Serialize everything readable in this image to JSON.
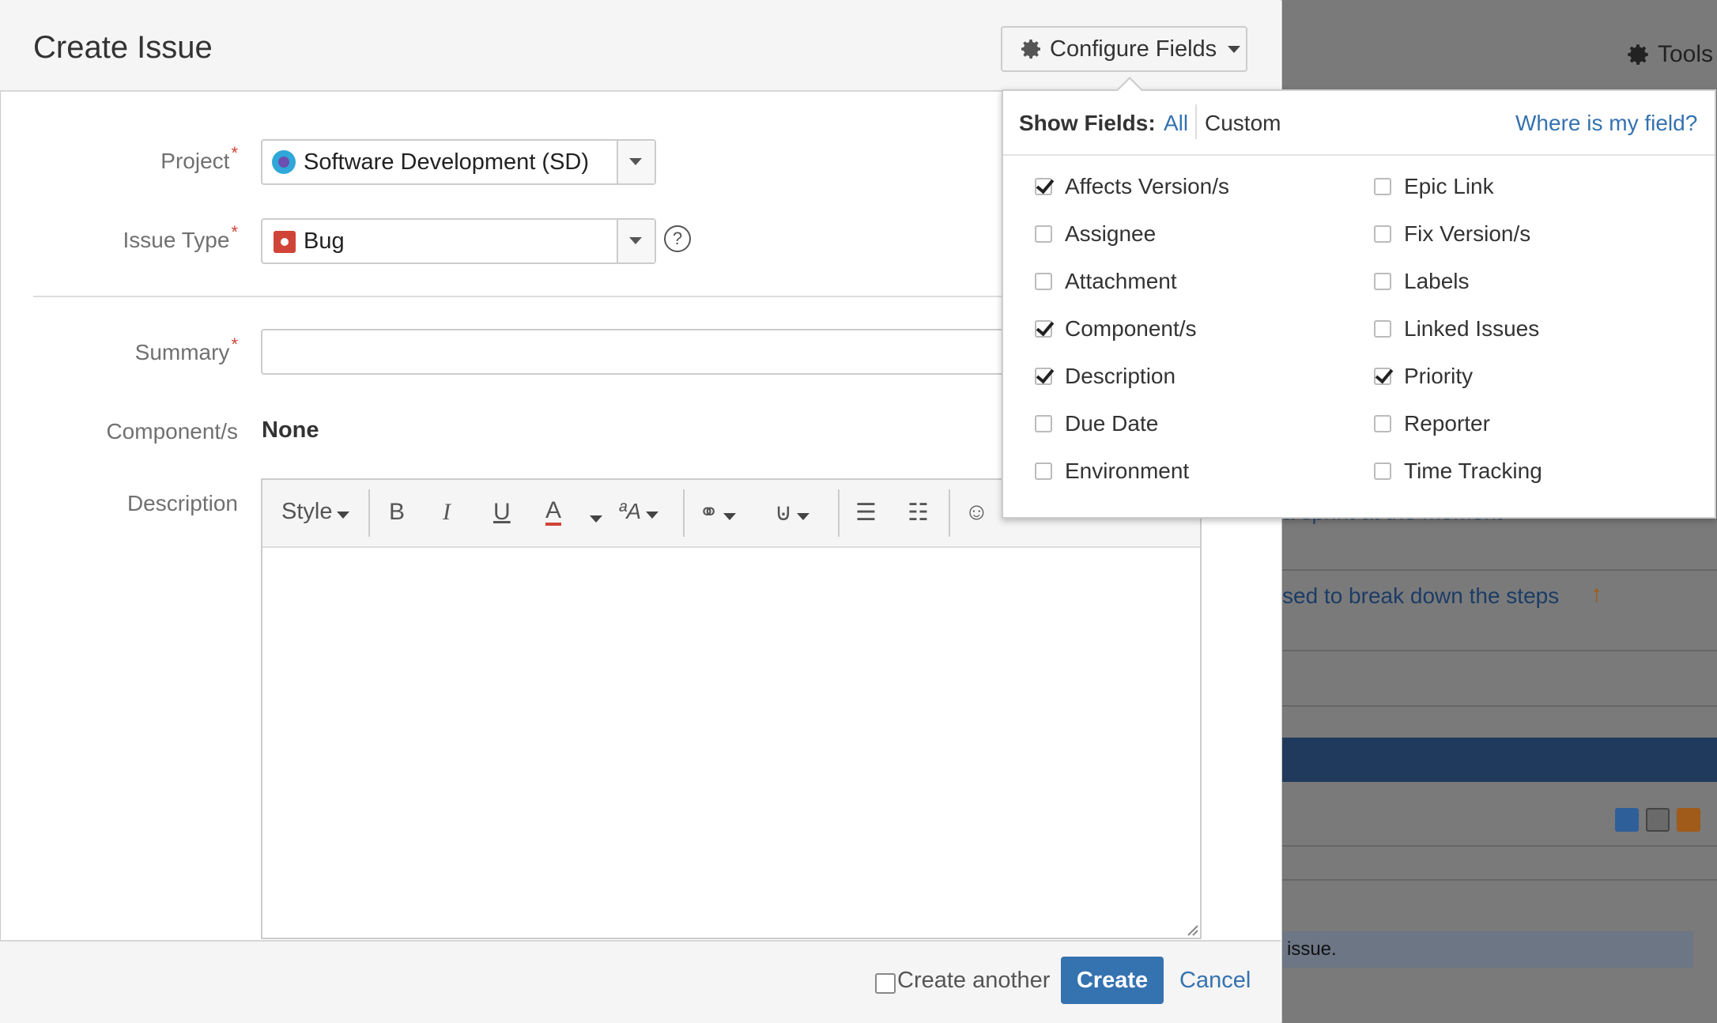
{
  "background": {
    "tools_label": "Tools",
    "link_text": "sed to break down the steps",
    "partial_text": "a sprint at the moment",
    "note_text": "issue."
  },
  "dialog": {
    "title": "Create Issue",
    "configure_label": "Configure Fields",
    "fields": {
      "project_label": "Project",
      "project_value": "Software Development (SD)",
      "issue_type_label": "Issue Type",
      "issue_type_value": "Bug",
      "summary_label": "Summary",
      "summary_value": "",
      "components_label": "Component/s",
      "components_value": "None",
      "description_label": "Description"
    },
    "editor": {
      "style_label": "Style",
      "bold": "B",
      "italic": "I",
      "underline": "U",
      "color": "A"
    },
    "footer": {
      "create_another_label": "Create another",
      "create_label": "Create",
      "cancel_label": "Cancel"
    }
  },
  "configure_panel": {
    "show_fields_label": "Show Fields:",
    "all_label": "All",
    "custom_label": "Custom",
    "where_label": "Where is my field?",
    "left_fields": [
      {
        "label": "Affects Version/s",
        "checked": true
      },
      {
        "label": "Assignee",
        "checked": false
      },
      {
        "label": "Attachment",
        "checked": false
      },
      {
        "label": "Component/s",
        "checked": true
      },
      {
        "label": "Description",
        "checked": true
      },
      {
        "label": "Due Date",
        "checked": false
      },
      {
        "label": "Environment",
        "checked": false
      }
    ],
    "right_fields": [
      {
        "label": "Epic Link",
        "checked": false
      },
      {
        "label": "Fix Version/s",
        "checked": false
      },
      {
        "label": "Labels",
        "checked": false
      },
      {
        "label": "Linked Issues",
        "checked": false
      },
      {
        "label": "Priority",
        "checked": true
      },
      {
        "label": "Reporter",
        "checked": false
      },
      {
        "label": "Time Tracking",
        "checked": false
      }
    ]
  },
  "colors": {
    "accent": "#3572b0",
    "required": "#d04437",
    "bug": "#d04437"
  }
}
